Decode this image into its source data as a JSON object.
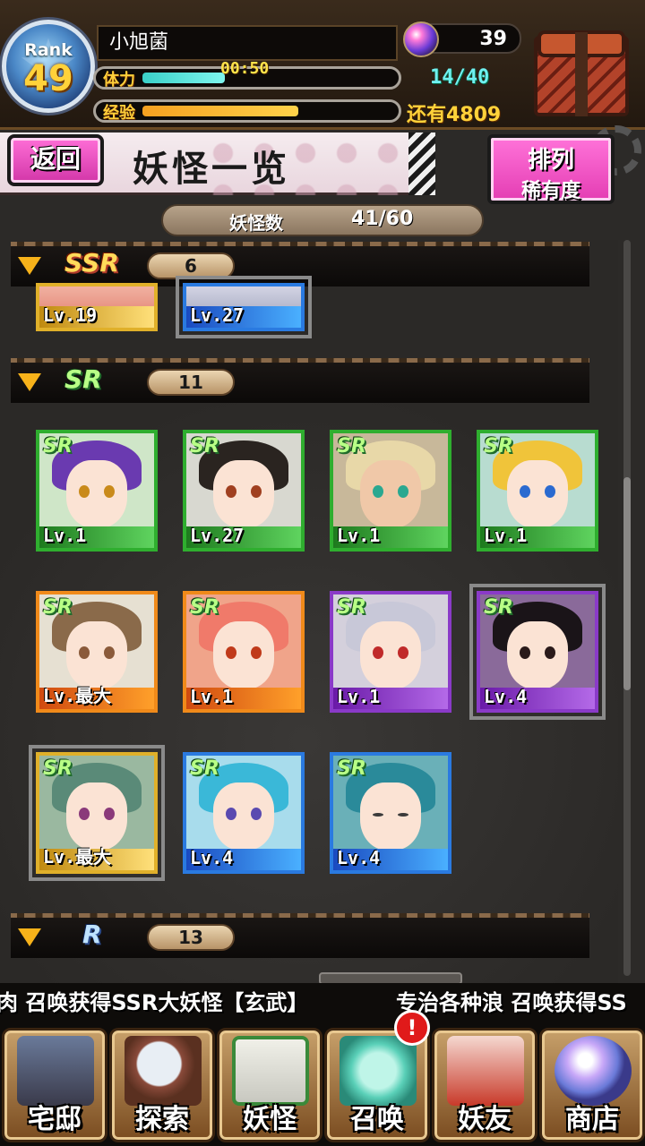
{
  "status": {
    "rank_label": "Rank",
    "rank": "49",
    "player_name": "小旭菌",
    "stamina_label": "体力",
    "stamina_timer": "00:50",
    "stamina_value": "14/40",
    "stamina_fill": 0.33,
    "exp_label": "经验",
    "exp_remaining": "还有4809",
    "exp_fill": 0.62,
    "gems": "39"
  },
  "header": {
    "back_label": "返回",
    "title": "妖怪一览",
    "sort_line1": "排列",
    "sort_line2": "稀有度",
    "count_label": "妖怪数",
    "count_value": "41/60"
  },
  "groups": {
    "ssr": {
      "tag": "SSR",
      "count": "6"
    },
    "sr": {
      "tag": "SR",
      "count": "11"
    },
    "r": {
      "tag": "R",
      "count": "13"
    }
  },
  "ssr_cards": [
    {
      "level": "Lv.19"
    },
    {
      "level": "Lv.27"
    }
  ],
  "sr_cards": [
    {
      "badge": "SR",
      "level": "Lv.1"
    },
    {
      "badge": "SR",
      "level": "Lv.27"
    },
    {
      "badge": "SR",
      "level": "Lv.1"
    },
    {
      "badge": "SR",
      "level": "Lv.1"
    },
    {
      "badge": "SR",
      "level": "Lv.最大"
    },
    {
      "badge": "SR",
      "level": "Lv.1"
    },
    {
      "badge": "SR",
      "level": "Lv.1"
    },
    {
      "badge": "SR",
      "level": "Lv.4"
    },
    {
      "badge": "SR",
      "level": "Lv.最大"
    },
    {
      "badge": "SR",
      "level": "Lv.4"
    },
    {
      "badge": "SR",
      "level": "Lv.4"
    }
  ],
  "ticker": {
    "text1": "肉 召唤获得SSR大妖怪【玄武】",
    "text2": "专治各种浪 召唤获得SS"
  },
  "nav": {
    "home": "宅邸",
    "explore": "探索",
    "yokai": "妖怪",
    "summon": "召唤",
    "friends": "妖友",
    "shop": "商店",
    "summon_badge": "!"
  }
}
